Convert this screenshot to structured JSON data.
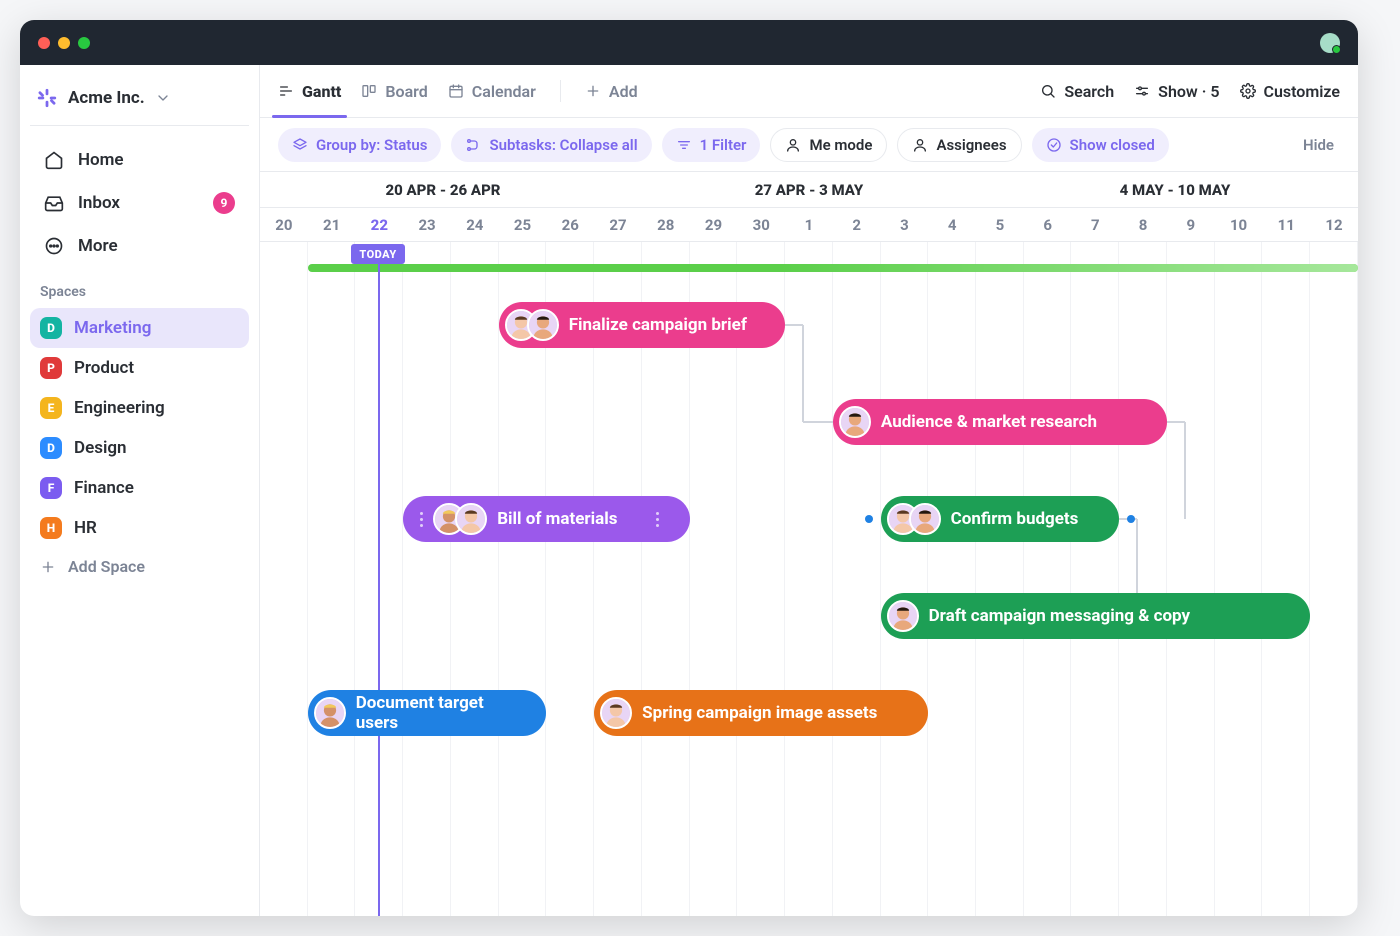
{
  "titlebar": {},
  "workspace": {
    "name": "Acme Inc."
  },
  "sidebar": {
    "items": [
      {
        "label": "Home"
      },
      {
        "label": "Inbox",
        "badge": "9"
      },
      {
        "label": "More"
      }
    ],
    "section_label": "Spaces",
    "spaces": [
      {
        "letter": "D",
        "label": "Marketing",
        "color": "#14b4a2",
        "active": true
      },
      {
        "letter": "P",
        "label": "Product",
        "color": "#e03a3a"
      },
      {
        "letter": "E",
        "label": "Engineering",
        "color": "#f4b51e"
      },
      {
        "letter": "D",
        "label": "Design",
        "color": "#2c8cff"
      },
      {
        "letter": "F",
        "label": "Finance",
        "color": "#7b5cf0"
      },
      {
        "letter": "H",
        "label": "HR",
        "color": "#f47b1e"
      }
    ],
    "add_space": "Add Space"
  },
  "views": {
    "tabs": [
      {
        "label": "Gantt",
        "active": true
      },
      {
        "label": "Board"
      },
      {
        "label": "Calendar"
      }
    ],
    "add_label": "Add",
    "right": {
      "search": "Search",
      "show": "Show · 5",
      "customize": "Customize"
    }
  },
  "filterbar": {
    "group_by": "Group by: Status",
    "subtasks": "Subtasks: Collapse all",
    "filter": "1 Filter",
    "me_mode": "Me mode",
    "assignees": "Assignees",
    "show_closed": "Show closed",
    "hide": "Hide"
  },
  "timeline": {
    "weeks": [
      "20 APR - 26 APR",
      "27 APR - 3 MAY",
      "4 MAY - 10 MAY"
    ],
    "days": [
      "20",
      "21",
      "22",
      "23",
      "24",
      "25",
      "26",
      "27",
      "28",
      "29",
      "30",
      "1",
      "2",
      "3",
      "4",
      "5",
      "6",
      "7",
      "8",
      "9",
      "10",
      "11",
      "12"
    ],
    "today_index": 2,
    "today_label": "TODAY"
  },
  "tasks": [
    {
      "label": "Finalize campaign brief",
      "color": "pink",
      "start": 5,
      "span": 6,
      "row": 0,
      "assignees": 2
    },
    {
      "label": "Audience & market research",
      "color": "pink",
      "start": 12,
      "span": 7,
      "row": 1,
      "assignees": 1
    },
    {
      "label": "Bill of materials",
      "color": "violet",
      "start": 3,
      "span": 6,
      "row": 2,
      "assignees": 2,
      "selected": true
    },
    {
      "label": "Confirm budgets",
      "color": "green",
      "start": 13,
      "span": 5,
      "row": 2,
      "assignees": 2,
      "sel_dots": true
    },
    {
      "label": "Draft campaign messaging & copy",
      "color": "green",
      "start": 13,
      "span": 9,
      "row": 3,
      "assignees": 1
    },
    {
      "label": "Document target users",
      "color": "blue",
      "start": 1,
      "span": 5,
      "row": 4,
      "assignees": 1
    },
    {
      "label": "Spring campaign image assets",
      "color": "orange",
      "start": 7,
      "span": 7,
      "row": 4,
      "assignees": 1
    }
  ]
}
